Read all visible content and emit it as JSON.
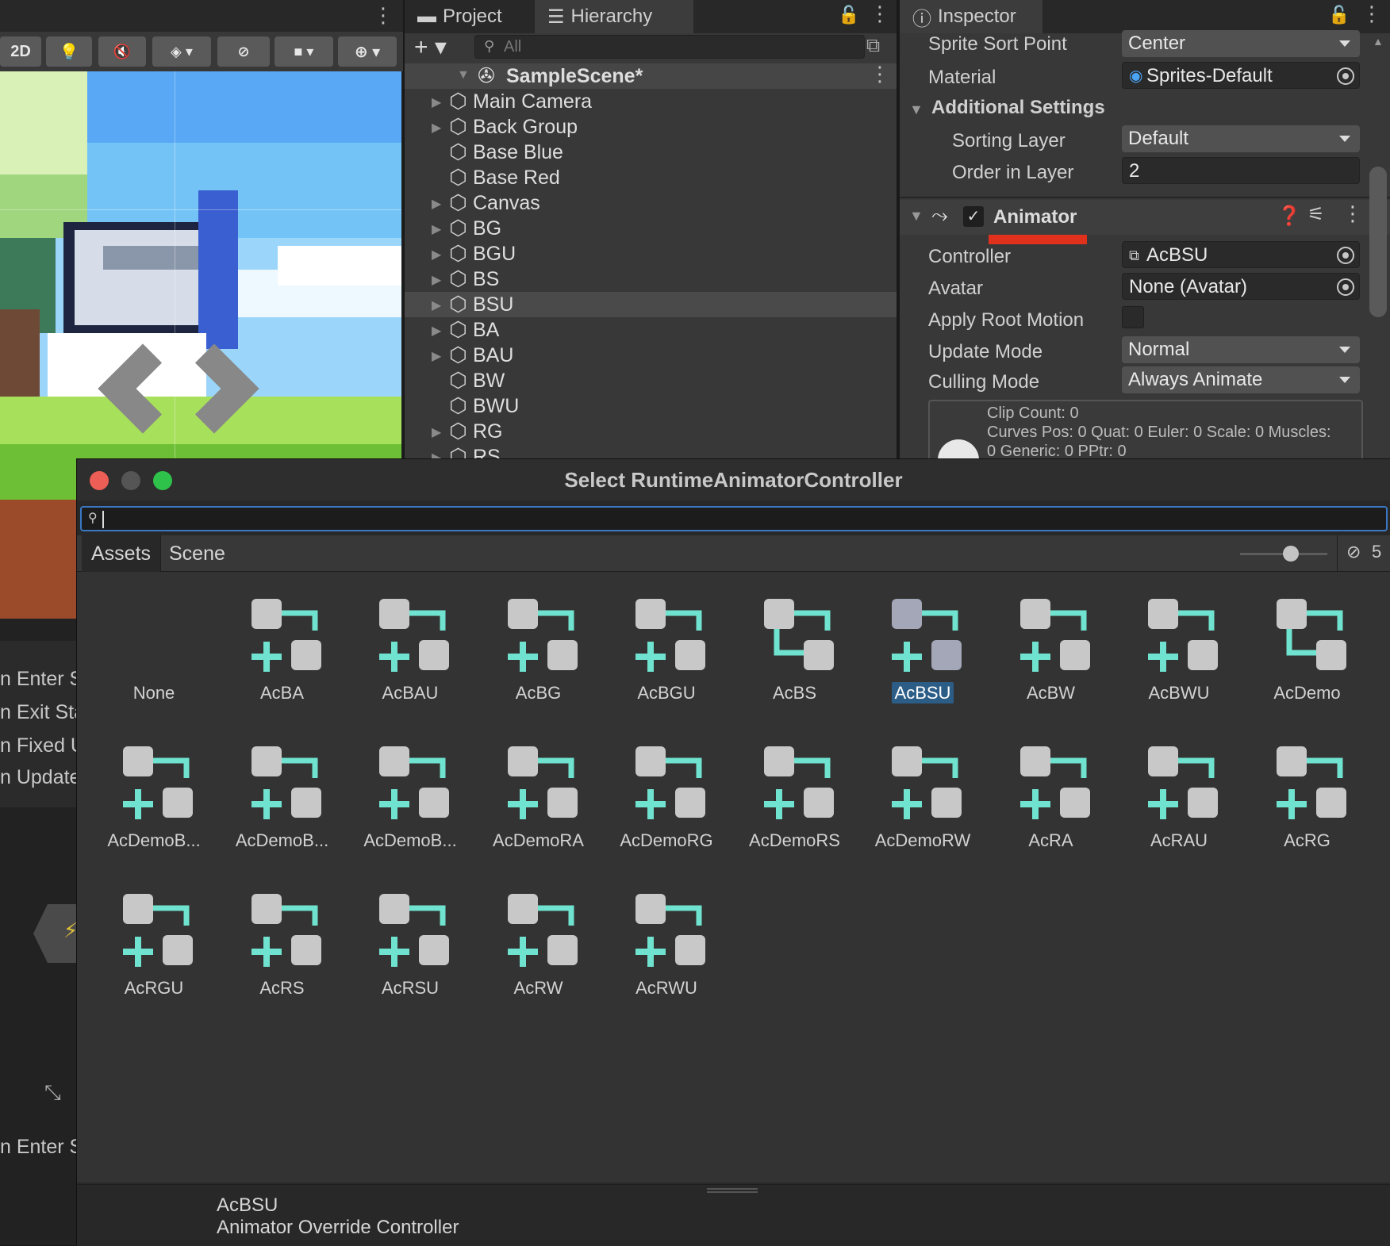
{
  "scene": {
    "toolbar": {
      "mode_2d": "2D"
    }
  },
  "left_lower": {
    "lines": [
      "n Enter S",
      "n Exit Sta",
      "n Fixed U",
      "n Update",
      "n Enter S"
    ]
  },
  "hierarchy": {
    "tabs": [
      "Project",
      "Hierarchy"
    ],
    "search_placeholder": "All",
    "scene_name": "SampleScene*",
    "items": [
      {
        "label": "Main Camera",
        "expandable": true
      },
      {
        "label": "Back Group",
        "expandable": true
      },
      {
        "label": "Base Blue",
        "expandable": false
      },
      {
        "label": "Base Red",
        "expandable": false
      },
      {
        "label": "Canvas",
        "expandable": true
      },
      {
        "label": "BG",
        "expandable": true
      },
      {
        "label": "BGU",
        "expandable": true
      },
      {
        "label": "BS",
        "expandable": true
      },
      {
        "label": "BSU",
        "expandable": true,
        "selected": true
      },
      {
        "label": "BA",
        "expandable": true
      },
      {
        "label": "BAU",
        "expandable": true
      },
      {
        "label": "BW",
        "expandable": false
      },
      {
        "label": "BWU",
        "expandable": false
      },
      {
        "label": "RG",
        "expandable": true
      },
      {
        "label": "RS",
        "expandable": true
      }
    ]
  },
  "inspector": {
    "tab": "Inspector",
    "sprite_sort_point": {
      "label": "Sprite Sort Point",
      "value": "Center"
    },
    "material": {
      "label": "Material",
      "value": "Sprites-Default"
    },
    "additional_settings": "Additional Settings",
    "sorting_layer": {
      "label": "Sorting Layer",
      "value": "Default"
    },
    "order_in_layer": {
      "label": "Order in Layer",
      "value": "2"
    },
    "animator": {
      "title": "Animator",
      "controller": {
        "label": "Controller",
        "value": "AcBSU"
      },
      "avatar": {
        "label": "Avatar",
        "value": "None (Avatar)"
      },
      "apply_root_motion": {
        "label": "Apply Root Motion"
      },
      "update_mode": {
        "label": "Update Mode",
        "value": "Normal"
      },
      "culling_mode": {
        "label": "Culling Mode",
        "value": "Always Animate"
      },
      "info": [
        "Clip Count: 0",
        "Curves Pos: 0 Quat: 0 Euler: 0 Scale: 0 Muscles:",
        "0 Generic: 0 PPtr: 0"
      ]
    }
  },
  "picker": {
    "title": "Select RuntimeAnimatorController",
    "tabs": [
      "Assets",
      "Scene"
    ],
    "hidden_count": "5",
    "items": [
      "None",
      "AcBA",
      "AcBAU",
      "AcBG",
      "AcBGU",
      "AcBS",
      "AcBSU",
      "AcBW",
      "AcBWU",
      "AcDemo",
      "AcDemoB...",
      "AcDemoB...",
      "AcDemoB...",
      "AcDemoRA",
      "AcDemoRG",
      "AcDemoRS",
      "AcDemoRW",
      "AcRA",
      "AcRAU",
      "AcRG",
      "AcRGU",
      "AcRS",
      "AcRSU",
      "AcRW",
      "AcRWU"
    ],
    "selected": "AcBSU",
    "footer": {
      "name": "AcBSU",
      "type": "Animator Override Controller"
    }
  },
  "colors": {
    "accent": "#3a78c4",
    "selection": "#2c5d87",
    "teal": "#6fe3cf",
    "underline": "#e0311c"
  }
}
